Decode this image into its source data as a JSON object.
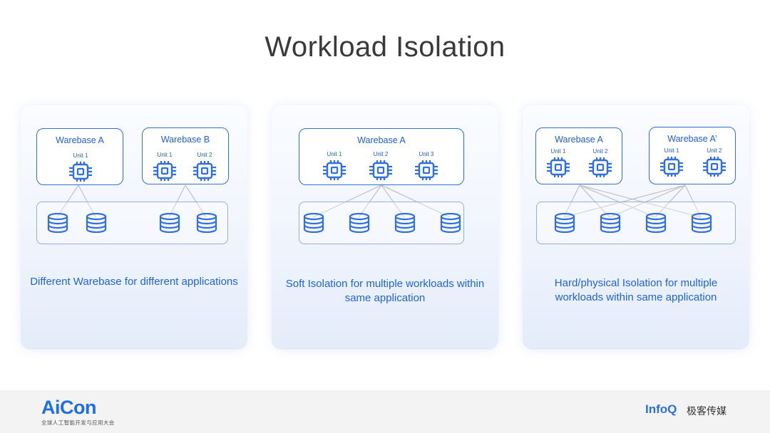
{
  "title": "Workload Isolation",
  "panels": [
    {
      "warebases": [
        {
          "name": "Warebase A",
          "units": [
            "Unit 1"
          ]
        },
        {
          "name": "Warebase B",
          "units": [
            "Unit 1",
            "Unit 2"
          ]
        }
      ],
      "storage_count": 4,
      "caption": "Different Warebase for different applications"
    },
    {
      "warebases": [
        {
          "name": "Warebase A",
          "units": [
            "Unit 1",
            "Unit 2",
            "Unit 3"
          ]
        }
      ],
      "storage_count": 4,
      "caption": "Soft Isolation for multiple workloads within same application"
    },
    {
      "warebases": [
        {
          "name": "Warebase A",
          "units": [
            "Unit 1",
            "Unit 2"
          ]
        },
        {
          "name": "Warebase A’",
          "units": [
            "Unit 1",
            "Unit 2"
          ]
        }
      ],
      "storage_count": 4,
      "caption": "Hard/physical Isolation for multiple workloads within same application"
    }
  ],
  "footer": {
    "left_logo": "AiCon",
    "left_tagline": "全球人工智能开发与应用大会",
    "right_logo": "InfoQ",
    "right_cn": "极客传媒"
  },
  "colors": {
    "accent": "#1f5fd6",
    "line": "#c4c4c4",
    "panel_bg": "#eef3fc"
  },
  "icons": {
    "unit": "cpu-chip-icon",
    "storage": "database-icon"
  }
}
